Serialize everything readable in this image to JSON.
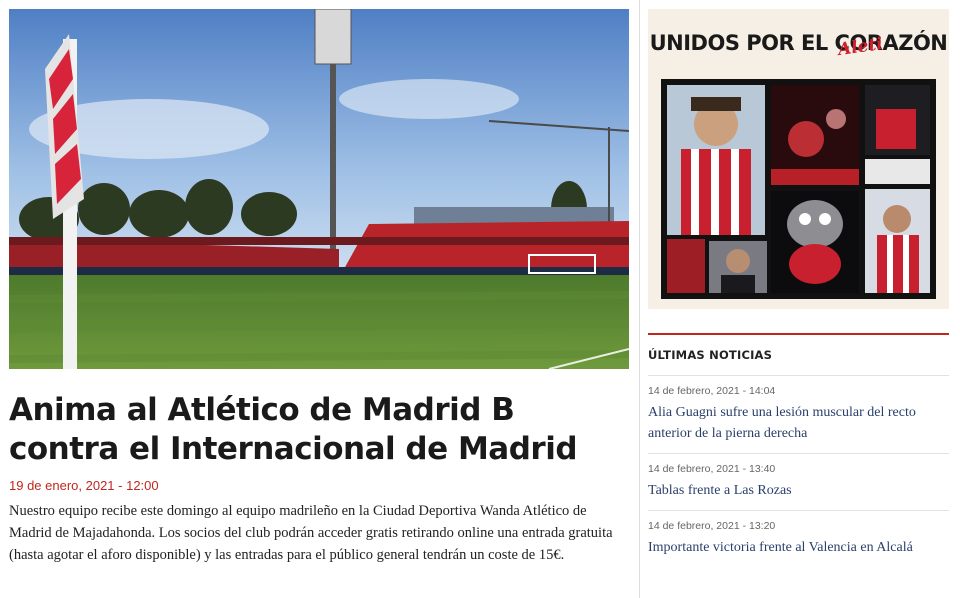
{
  "article": {
    "title": "Anima al Atlético de Madrid B contra el Internacional de Madrid",
    "date": "19 de enero, 2021 - 12:00",
    "body": "Nuestro equipo recibe este domingo al equipo madrileño en la Ciudad Deportiva Wanda Atlético de Madrid de Majadahonda. Los socios del club podrán acceder gratis retirando online una entrada gratuita (hasta agotar el aforo disponible) y las entradas para el público general tendrán un coste de 15€."
  },
  "promo": {
    "title": "UNIDOS POR EL CORAZÓN",
    "script": "Aleti",
    "accent": "#d0202e",
    "background": "#f6efe5"
  },
  "latest": {
    "heading": "ÚLTIMAS NOTICIAS",
    "items": [
      {
        "date": "14 de febrero, 2021 - 14:04",
        "title": "Alia Guagni sufre una lesión muscular del recto anterior de la pierna derecha"
      },
      {
        "date": "14 de febrero, 2021 - 13:40",
        "title": "Tablas frente a Las Rozas"
      },
      {
        "date": "14 de febrero, 2021 - 13:20",
        "title": "Importante victoria frente al Valencia en Alcalá"
      }
    ]
  },
  "colors": {
    "accent_red": "#c0271f",
    "link_blue": "#2a3f6a"
  }
}
